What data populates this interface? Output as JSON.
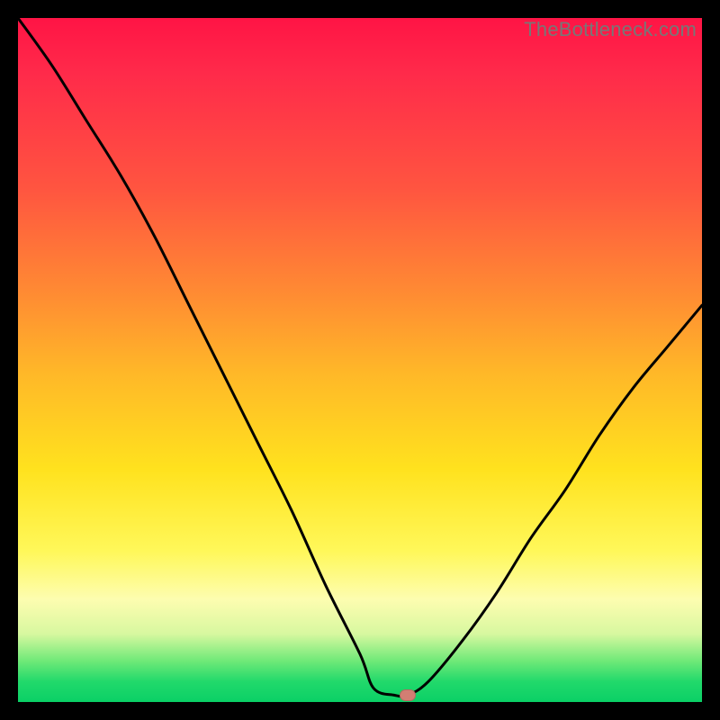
{
  "watermark": "TheBottleneck.com",
  "colors": {
    "frame": "#000000",
    "curve": "#000000",
    "marker": "#d27e73",
    "gradient_stops": [
      "#ff1445",
      "#ff2a4a",
      "#ff5540",
      "#ff8a33",
      "#ffb828",
      "#ffe21e",
      "#fff85a",
      "#fdfdb0",
      "#d8f8a0",
      "#6fe978",
      "#22d96b",
      "#0ad066"
    ]
  },
  "chart_data": {
    "type": "line",
    "title": "",
    "xlabel": "",
    "ylabel": "",
    "xlim": [
      0,
      100
    ],
    "ylim": [
      0,
      100
    ],
    "grid": false,
    "note": "Values estimated from pixel positions; y is percentage height (0 at bottom, 100 at top).",
    "series": [
      {
        "name": "curve",
        "x": [
          0,
          5,
          10,
          15,
          20,
          25,
          30,
          35,
          40,
          45,
          50,
          52,
          55,
          57,
          60,
          65,
          70,
          75,
          80,
          85,
          90,
          95,
          100
        ],
        "values": [
          100,
          93,
          85,
          77,
          68,
          58,
          48,
          38,
          28,
          17,
          7,
          2,
          1,
          1,
          3,
          9,
          16,
          24,
          31,
          39,
          46,
          52,
          58
        ]
      }
    ],
    "marker": {
      "x": 57,
      "y": 1
    }
  }
}
